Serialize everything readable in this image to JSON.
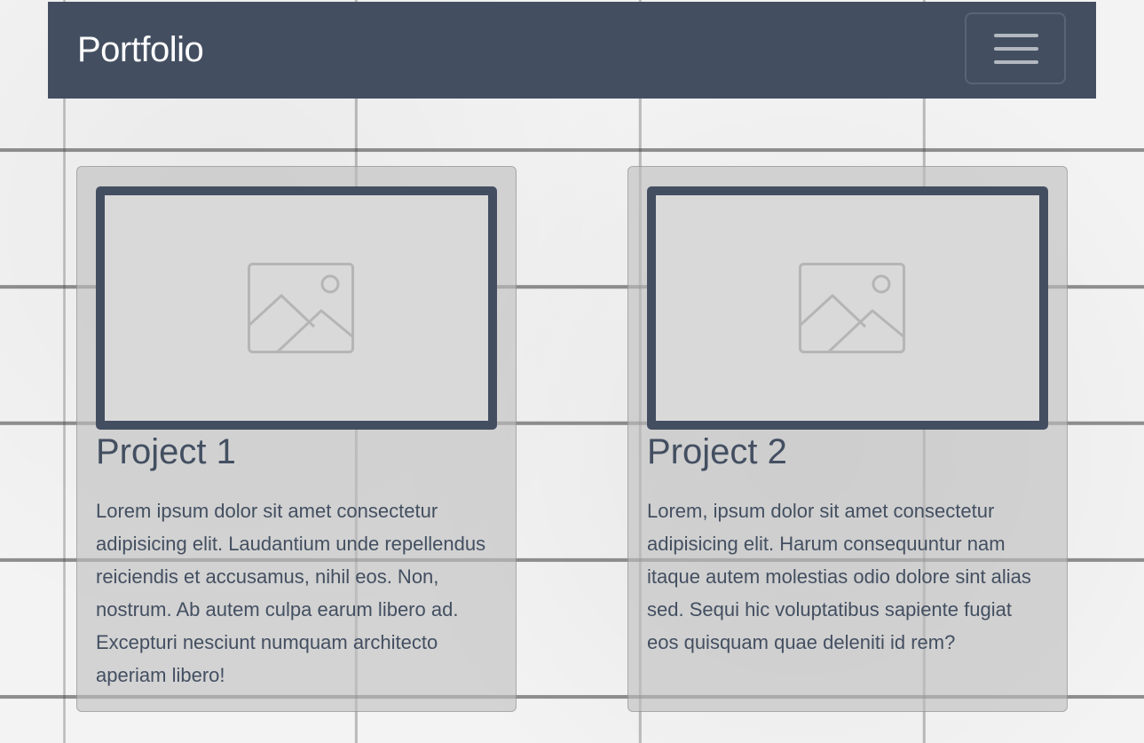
{
  "navbar": {
    "brand": "Portfolio",
    "toggle_icon": "hamburger-menu-icon",
    "background": "#434f61"
  },
  "projects": [
    {
      "title": "Project 1",
      "image_icon": "image-placeholder-icon",
      "description": "Lorem ipsum dolor sit amet consectetur adipisicing elit. Laudantium unde repellendus reiciendis et accusamus, nihil eos. Non, nostrum. Ab autem culpa earum libero ad. Excepturi nesciunt numquam architecto aperiam libero!"
    },
    {
      "title": "Project 2",
      "image_icon": "image-placeholder-icon",
      "description": "Lorem, ipsum dolor sit amet consectetur adipisicing elit. Harum consequuntur nam itaque autem molestias odio dolore sint alias sed. Sequi hic voluptatibus sapiente fugiat eos quisquam quae deleniti id rem?"
    }
  ],
  "colors": {
    "accent": "#434f61",
    "card_bg": "#bebebe",
    "placeholder_bg": "#d9d9d9"
  }
}
